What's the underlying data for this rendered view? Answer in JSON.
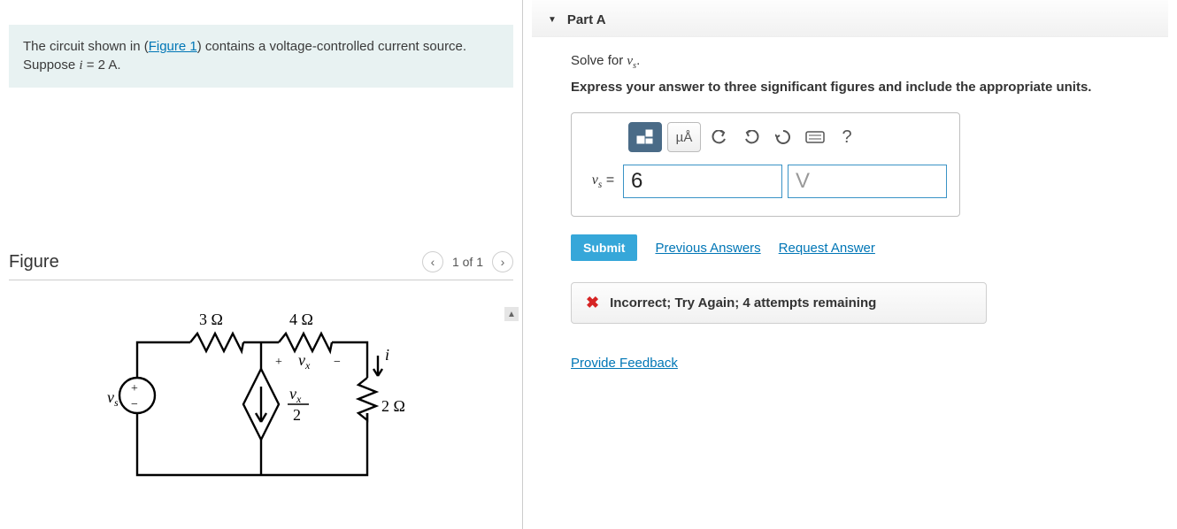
{
  "prompt": {
    "pre": "The circuit shown in (",
    "link": "Figure 1",
    "post1": ") contains a voltage-controlled current source. Suppose ",
    "var": "i",
    "post2": " = 2 A."
  },
  "figure": {
    "title": "Figure",
    "pager": "1 of 1",
    "labels": {
      "r3": "3 Ω",
      "r4": "4 Ω",
      "r2": "2 Ω",
      "vs": "v",
      "vs_sub": "s",
      "vx": "v",
      "vx_sub": "x",
      "i": "i",
      "frac_top": "v",
      "frac_top_sub": "x",
      "frac_bot": "2",
      "plus": "+",
      "minus": "−"
    }
  },
  "part": {
    "label": "Part A",
    "solve_pre": "Solve for ",
    "solve_var": "v",
    "solve_sub": "s",
    "solve_post": ".",
    "instructions": "Express your answer to three significant figures and include the appropriate units."
  },
  "toolbar": {
    "units_btn": "µÅ",
    "help": "?"
  },
  "answer": {
    "label_var": "v",
    "label_sub": "s",
    "label_eq": " = ",
    "value": "6",
    "unit": "V"
  },
  "actions": {
    "submit": "Submit",
    "previous": "Previous Answers",
    "request": "Request Answer"
  },
  "feedback": {
    "text": "Incorrect; Try Again; 4 attempts remaining"
  },
  "provide_feedback": "Provide Feedback"
}
